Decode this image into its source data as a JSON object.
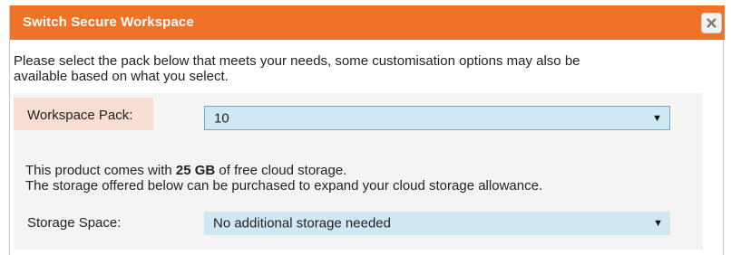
{
  "dialog": {
    "title": "Switch Secure Workspace",
    "close_icon": "close-icon",
    "intro_line1": "Please select the pack below that meets your needs, some customisation options may also be",
    "intro_line2": "available based on what you select."
  },
  "workspace_pack": {
    "label": "Workspace Pack:",
    "selected": "10",
    "arrow": "▼"
  },
  "storage_info": {
    "prefix": "This product comes with ",
    "amount": "25 GB",
    "suffix": " of free cloud storage.",
    "line2": "The storage offered below can be purchased to expand your cloud storage allowance."
  },
  "storage_space": {
    "label": "Storage Space:",
    "selected": "No additional storage needed",
    "arrow": "▼"
  },
  "colors": {
    "titlebar": "#f07128",
    "select_bg": "#cfe8f3",
    "label_highlight": "#f8ddd2",
    "panel_bg": "#f4f4f4"
  }
}
